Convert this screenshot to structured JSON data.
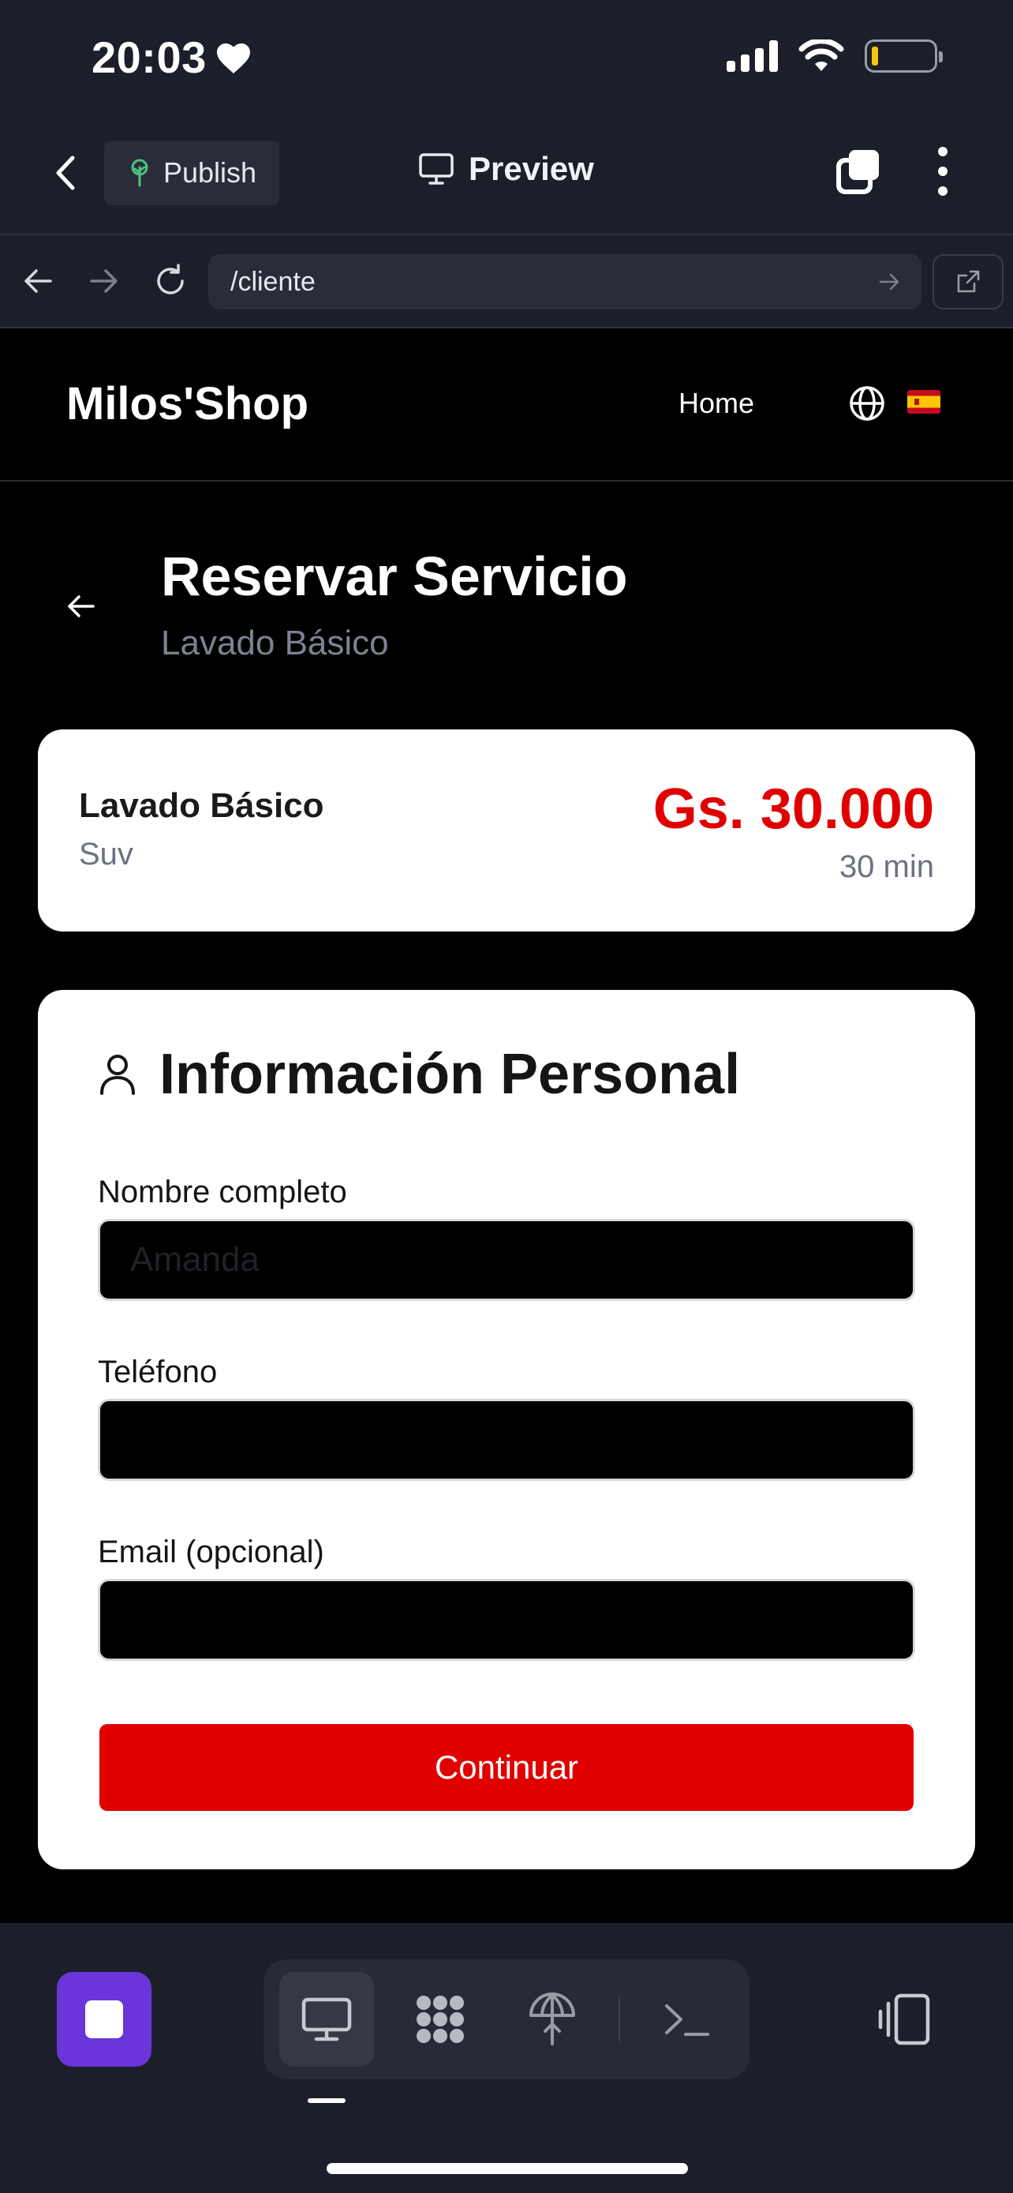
{
  "status_bar": {
    "time": "20:03"
  },
  "app_header": {
    "publish_label": "Publish",
    "preview_label": "Preview"
  },
  "browser": {
    "url": "/cliente"
  },
  "site_nav": {
    "brand": "Milos'Shop",
    "home_label": "Home",
    "language_flag": "Spain"
  },
  "page": {
    "title": "Reservar Servicio",
    "subtitle": "Lavado Básico"
  },
  "service": {
    "name": "Lavado Básico",
    "vehicle_type": "Suv",
    "price": "Gs. 30.000",
    "duration": "30 min"
  },
  "form": {
    "title": "Información Personal",
    "fields": [
      {
        "label": "Nombre completo",
        "placeholder": "Amanda",
        "value": ""
      },
      {
        "label": "Teléfono",
        "placeholder": "",
        "value": ""
      },
      {
        "label": "Email (opcional)",
        "placeholder": "",
        "value": ""
      }
    ],
    "submit_label": "Continuar"
  },
  "bottom_toolbar": {
    "active_tool": "preview",
    "tools": [
      "preview-icon",
      "apps-icon",
      "publish-icon",
      "terminal-icon"
    ]
  },
  "colors": {
    "accent_red": "#e00000",
    "chrome_bg": "#1c1e29",
    "stop_button": "#6a35d9",
    "muted_text": "#7d8292"
  }
}
